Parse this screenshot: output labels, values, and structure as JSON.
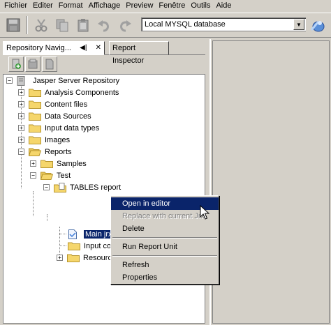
{
  "menubar": {
    "items": [
      "Fichier",
      "Editer",
      "Format",
      "Affichage",
      "Preview",
      "Fenêtre",
      "Outils",
      "Aide"
    ]
  },
  "toolbar": {
    "buttons": [
      "save-icon",
      "cut-icon",
      "copy-icon",
      "paste-icon",
      "undo-icon",
      "redo-icon"
    ],
    "datasource": "Local MYSQL database",
    "connect_icon": "database-connect-icon"
  },
  "tabs": {
    "repository": "Repository Navig...",
    "report_inspector": "Report Inspector"
  },
  "tree_toolbar": [
    "add-server-icon",
    "repository-icon",
    "document-icon"
  ],
  "tree": {
    "root": "Jasper Server Repository",
    "children": [
      "Analysis Components",
      "Content files",
      "Data Sources",
      "Input data types",
      "Images",
      "Reports"
    ],
    "reports_children": [
      "Samples",
      "Test"
    ],
    "test_children": [
      "TABLES report"
    ],
    "report_children": [
      "Main jrx",
      "Input co",
      "Resourc"
    ]
  },
  "context_menu": {
    "open_in_editor": "Open in editor",
    "replace_with_current": "Replace with current Jrx",
    "delete": "Delete",
    "run_report_unit": "Run Report Unit",
    "refresh": "Refresh",
    "properties": "Properties"
  },
  "colors": {
    "window_bg": "#d4d0c8",
    "selection": "#0a246a",
    "folder": "#f5d66c"
  }
}
